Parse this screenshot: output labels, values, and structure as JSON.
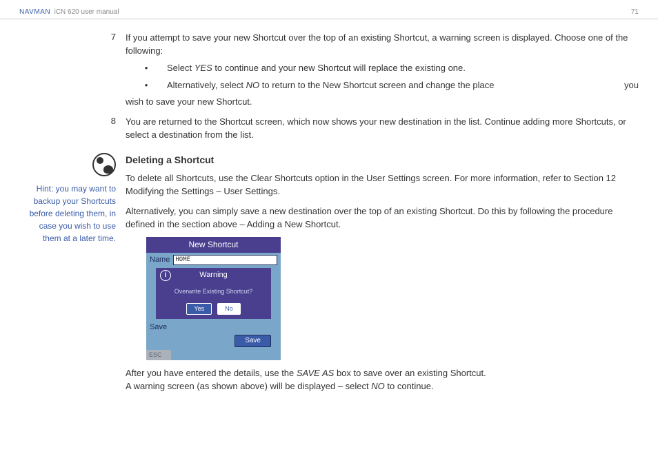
{
  "header": {
    "brand": "NAVMAN",
    "title": "iCN 620 user manual",
    "page": "71"
  },
  "step7": {
    "num": "7",
    "text": "If you attempt to save your new Shortcut over the top of an existing Shortcut, a warning screen is displayed. Choose one of the following:",
    "bullet1_pre": "Select ",
    "bullet1_yes": "YES",
    "bullet1_post": " to continue and your new Shortcut will replace the existing one.",
    "bullet2_pre": "Alternatively, select ",
    "bullet2_no": "NO",
    "bullet2_mid": " to return to the New Shortcut screen and change the place",
    "bullet2_tail": "you wish to save your new Shortcut."
  },
  "step8": {
    "num": "8",
    "text": "You are returned to the Shortcut screen, which now shows your new destination in the list. Continue adding more Shortcuts, or select a destination from the list."
  },
  "hint": "Hint: you may want to backup your Shortcuts before deleting them, in case you wish to use them at a later time.",
  "section": {
    "heading": "Deleting a Shortcut",
    "p1": "To delete all Shortcuts, use the Clear Shortcuts option in the User Settings screen. For more information, refer to Section 12 Modifying the Settings – User Settings.",
    "p2": "Alternatively, you can simply save a new destination over the top of an existing Shortcut. Do this by following the procedure defined in the section above – Adding a New Shortcut.",
    "after1_pre": "After you have entered the details, use the ",
    "after1_saveas": "SAVE AS",
    "after1_post": " box to save over an existing Shortcut.",
    "after2_pre": "A warning screen (as shown above) will be displayed – select ",
    "after2_no": "NO",
    "after2_post": " to continue."
  },
  "device": {
    "title": "New Shortcut",
    "name_label": "Name",
    "name_value": "HOME",
    "warn_title": "Warning",
    "warn_text": "Overwrite Existing Shortcut?",
    "yes": "Yes",
    "no": "No",
    "save_label": "Save",
    "save_btn": "Save",
    "esc": "ESC"
  }
}
